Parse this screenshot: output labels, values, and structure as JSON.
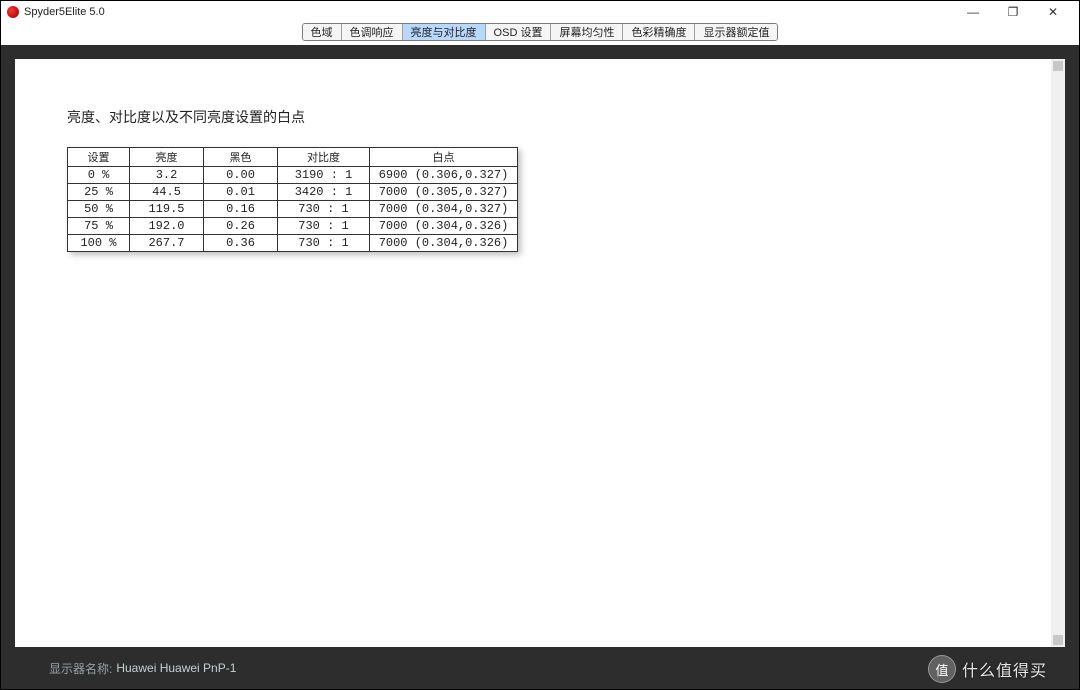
{
  "window": {
    "title": "Spyder5Elite 5.0"
  },
  "tabs": [
    {
      "label": "色域",
      "active": false
    },
    {
      "label": "色调响应",
      "active": false
    },
    {
      "label": "亮度与对比度",
      "active": true
    },
    {
      "label": "OSD 设置",
      "active": false
    },
    {
      "label": "屏幕均匀性",
      "active": false
    },
    {
      "label": "色彩精确度",
      "active": false
    },
    {
      "label": "显示器额定值",
      "active": false
    }
  ],
  "page": {
    "title": "亮度、对比度以及不同亮度设置的白点"
  },
  "table": {
    "headers": {
      "setting": "设置",
      "brightness": "亮度",
      "black": "黑色",
      "contrast": "对比度",
      "white": "白点"
    },
    "rows": [
      {
        "setting": "0 %",
        "brightness": "3.2",
        "black": "0.00",
        "contrast": "3190 : 1",
        "white": "6900  (0.306,0.327)"
      },
      {
        "setting": "25 %",
        "brightness": "44.5",
        "black": "0.01",
        "contrast": "3420 : 1",
        "white": "7000  (0.305,0.327)"
      },
      {
        "setting": "50 %",
        "brightness": "119.5",
        "black": "0.16",
        "contrast": "730 : 1",
        "white": "7000  (0.304,0.327)"
      },
      {
        "setting": "75 %",
        "brightness": "192.0",
        "black": "0.26",
        "contrast": "730 : 1",
        "white": "7000  (0.304,0.326)"
      },
      {
        "setting": "100 %",
        "brightness": "267.7",
        "black": "0.36",
        "contrast": "730 : 1",
        "white": "7000  (0.304,0.326)"
      }
    ]
  },
  "footer": {
    "label": "显示器名称:",
    "value": "Huawei Huawei PnP-1"
  },
  "watermark": {
    "badge": "值",
    "text": "什么值得买"
  },
  "icons": {
    "minimize": "—",
    "maximize": "❐",
    "close": "✕",
    "zoom_in": "⊕",
    "zoom_out": "⊖",
    "zoom_fit": "🔍"
  }
}
